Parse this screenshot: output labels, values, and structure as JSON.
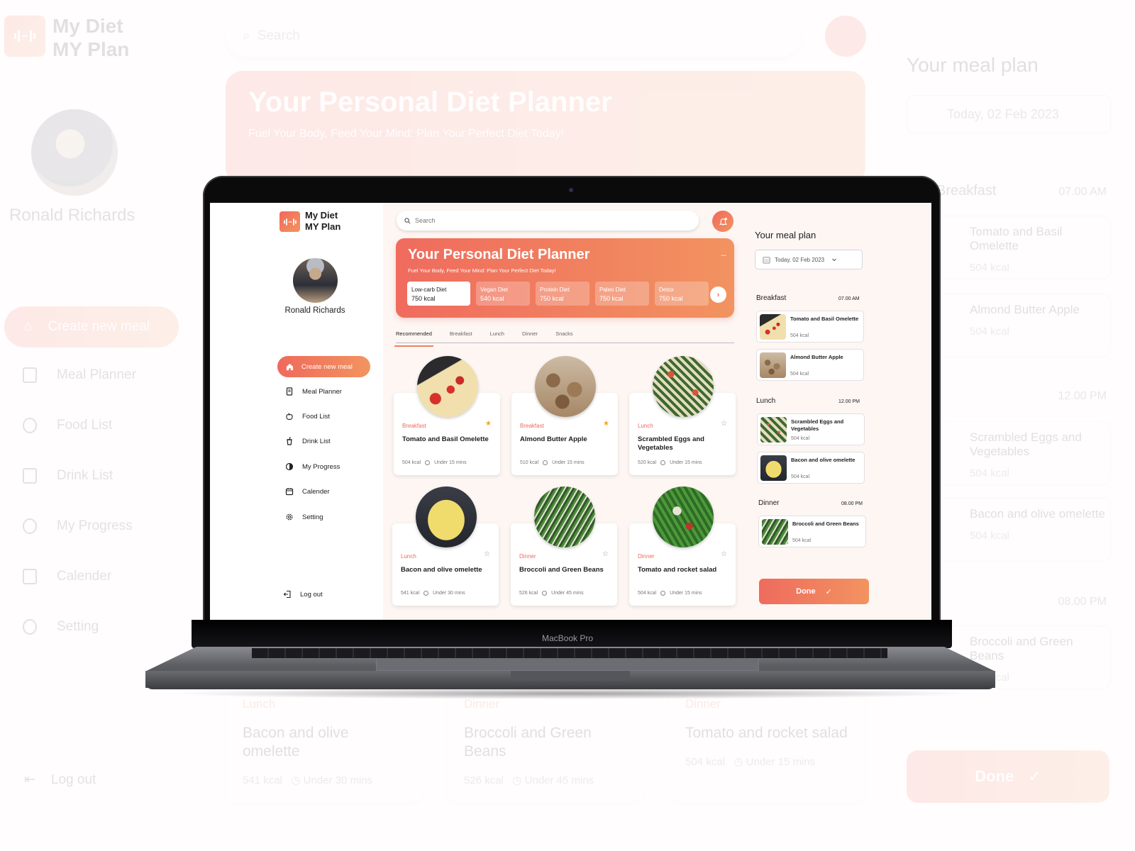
{
  "app": {
    "logo_line1": "My Diet",
    "logo_line2": "MY Plan",
    "user_name": "Ronald Richards"
  },
  "sidebar": {
    "create_label": "Create new meal",
    "items": [
      {
        "label": "Meal Planner",
        "icon": "document-icon"
      },
      {
        "label": "Food List",
        "icon": "apple-icon"
      },
      {
        "label": "Drink List",
        "icon": "cup-icon"
      },
      {
        "label": "My Progress",
        "icon": "progress-icon"
      },
      {
        "label": "Calender",
        "icon": "calendar-icon"
      },
      {
        "label": "Setting",
        "icon": "gear-icon"
      }
    ],
    "logout_label": "Log out"
  },
  "search": {
    "placeholder": "Search"
  },
  "hero": {
    "title": "Your Personal Diet Planner",
    "subtitle": "Fuel Your Body, Feed Your Mind: Plan Your Perfect Diet Today!",
    "diets": [
      {
        "name": "Low-carb Diet",
        "kcal": "750 kcal",
        "selected": true
      },
      {
        "name": "Vegan Diet",
        "kcal": "540 kcal",
        "selected": false
      },
      {
        "name": "Protein Diet",
        "kcal": "750 kcal",
        "selected": false
      },
      {
        "name": "Paleo Diet",
        "kcal": "750 kcal",
        "selected": false
      },
      {
        "name": "Detox",
        "kcal": "750 kcal",
        "selected": false
      }
    ],
    "more": "...",
    "next": "›"
  },
  "tabs": [
    {
      "label": "Recommended",
      "active": true
    },
    {
      "label": "Breakfast",
      "active": false
    },
    {
      "label": "Lunch",
      "active": false
    },
    {
      "label": "Dinner",
      "active": false
    },
    {
      "label": "Snacks",
      "active": false
    }
  ],
  "meals": [
    {
      "category": "Breakfast",
      "name": "Tomato and Basil Omelette",
      "kcal": "504 kcal",
      "time": "Under 15 mins",
      "favorite": true
    },
    {
      "category": "Breakfast",
      "name": "Almond Butter Apple",
      "kcal": "510 kcal",
      "time": "Under 15 mins",
      "favorite": true
    },
    {
      "category": "Lunch",
      "name": "Scrambled Eggs and Vegetables",
      "kcal": "520 kcal",
      "time": "Under 15 mins",
      "favorite": false
    },
    {
      "category": "Lunch",
      "name": "Bacon and olive omelette",
      "kcal": "541 kcal",
      "time": "Under 30 mins",
      "favorite": false
    },
    {
      "category": "Dinner",
      "name": "Broccoli and Green Beans",
      "kcal": "526 kcal",
      "time": "Under 45 mins",
      "favorite": false
    },
    {
      "category": "Dinner",
      "name": "Tomato and rocket salad",
      "kcal": "504 kcal",
      "time": "Under 15 mins",
      "favorite": false
    }
  ],
  "meal_plan": {
    "title": "Your meal plan",
    "date": "Today, 02 Feb 2023",
    "sections": [
      {
        "name": "Breakfast",
        "time": "07.00 AM",
        "items": [
          {
            "name": "Tomato and Basil Omelette",
            "kcal": "504 kcal"
          },
          {
            "name": "Almond Butter Apple",
            "kcal": "504 kcal"
          }
        ]
      },
      {
        "name": "Lunch",
        "time": "12.00 PM",
        "items": [
          {
            "name": "Scrambled Eggs and Vegetables",
            "kcal": "504 kcal"
          },
          {
            "name": "Bacon and olive omelette",
            "kcal": "504 kcal"
          }
        ]
      },
      {
        "name": "Dinner",
        "time": "08.00 PM",
        "items": [
          {
            "name": "Broccoli and Green Beans",
            "kcal": "504 kcal"
          }
        ]
      }
    ],
    "done_label": "Done",
    "done_icon": "✓"
  },
  "device": {
    "brand_label": "MacBook Pro"
  },
  "colors": {
    "accent_start": "#f0695c",
    "accent_end": "#f2945f",
    "favorite_star": "#f5a623",
    "background": "#fdf6f3"
  }
}
